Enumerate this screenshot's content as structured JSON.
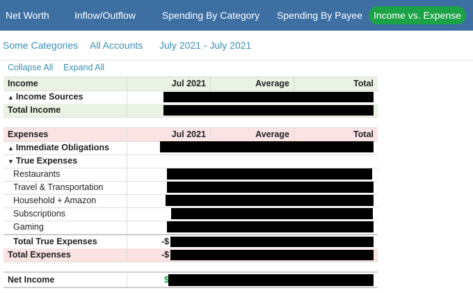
{
  "nav": {
    "items": [
      "Net Worth",
      "Inflow/Outflow",
      "Spending By Category",
      "Spending By Payee"
    ],
    "active": "Income vs. Expense"
  },
  "filters": {
    "categories": "Some Categories",
    "accounts": "All Accounts",
    "date_range": "July 2021 - July 2021"
  },
  "controls": {
    "collapse": "Collapse All",
    "expand": "Expand All"
  },
  "income": {
    "header": {
      "label": "Income",
      "col1": "Jul 2021",
      "col2": "Average",
      "col3": "Total"
    },
    "group": "Income Sources",
    "total": "Total Income"
  },
  "expenses": {
    "header": {
      "label": "Expenses",
      "col1": "Jul 2021",
      "col2": "Average",
      "col3": "Total"
    },
    "groups": [
      "Immediate Obligations",
      "True Expenses"
    ],
    "items": [
      "Restaurants",
      "Travel & Transportation",
      "Household + Amazon",
      "Subscriptions",
      "Gaming"
    ],
    "total_true": "Total True Expenses",
    "total": "Total Expenses",
    "neg_prefix": "-$"
  },
  "net": {
    "label": "Net Income",
    "prefix": "$"
  },
  "colors": {
    "nav_bg": "#3d6fa3",
    "active_pill": "#1ca346",
    "link": "#3a8fb3",
    "income_bg": "#e9f2e3",
    "expense_bg": "#fbe3e3"
  },
  "icons": {
    "expanded": "triangle-up-icon",
    "collapsed": "triangle-down-icon"
  }
}
